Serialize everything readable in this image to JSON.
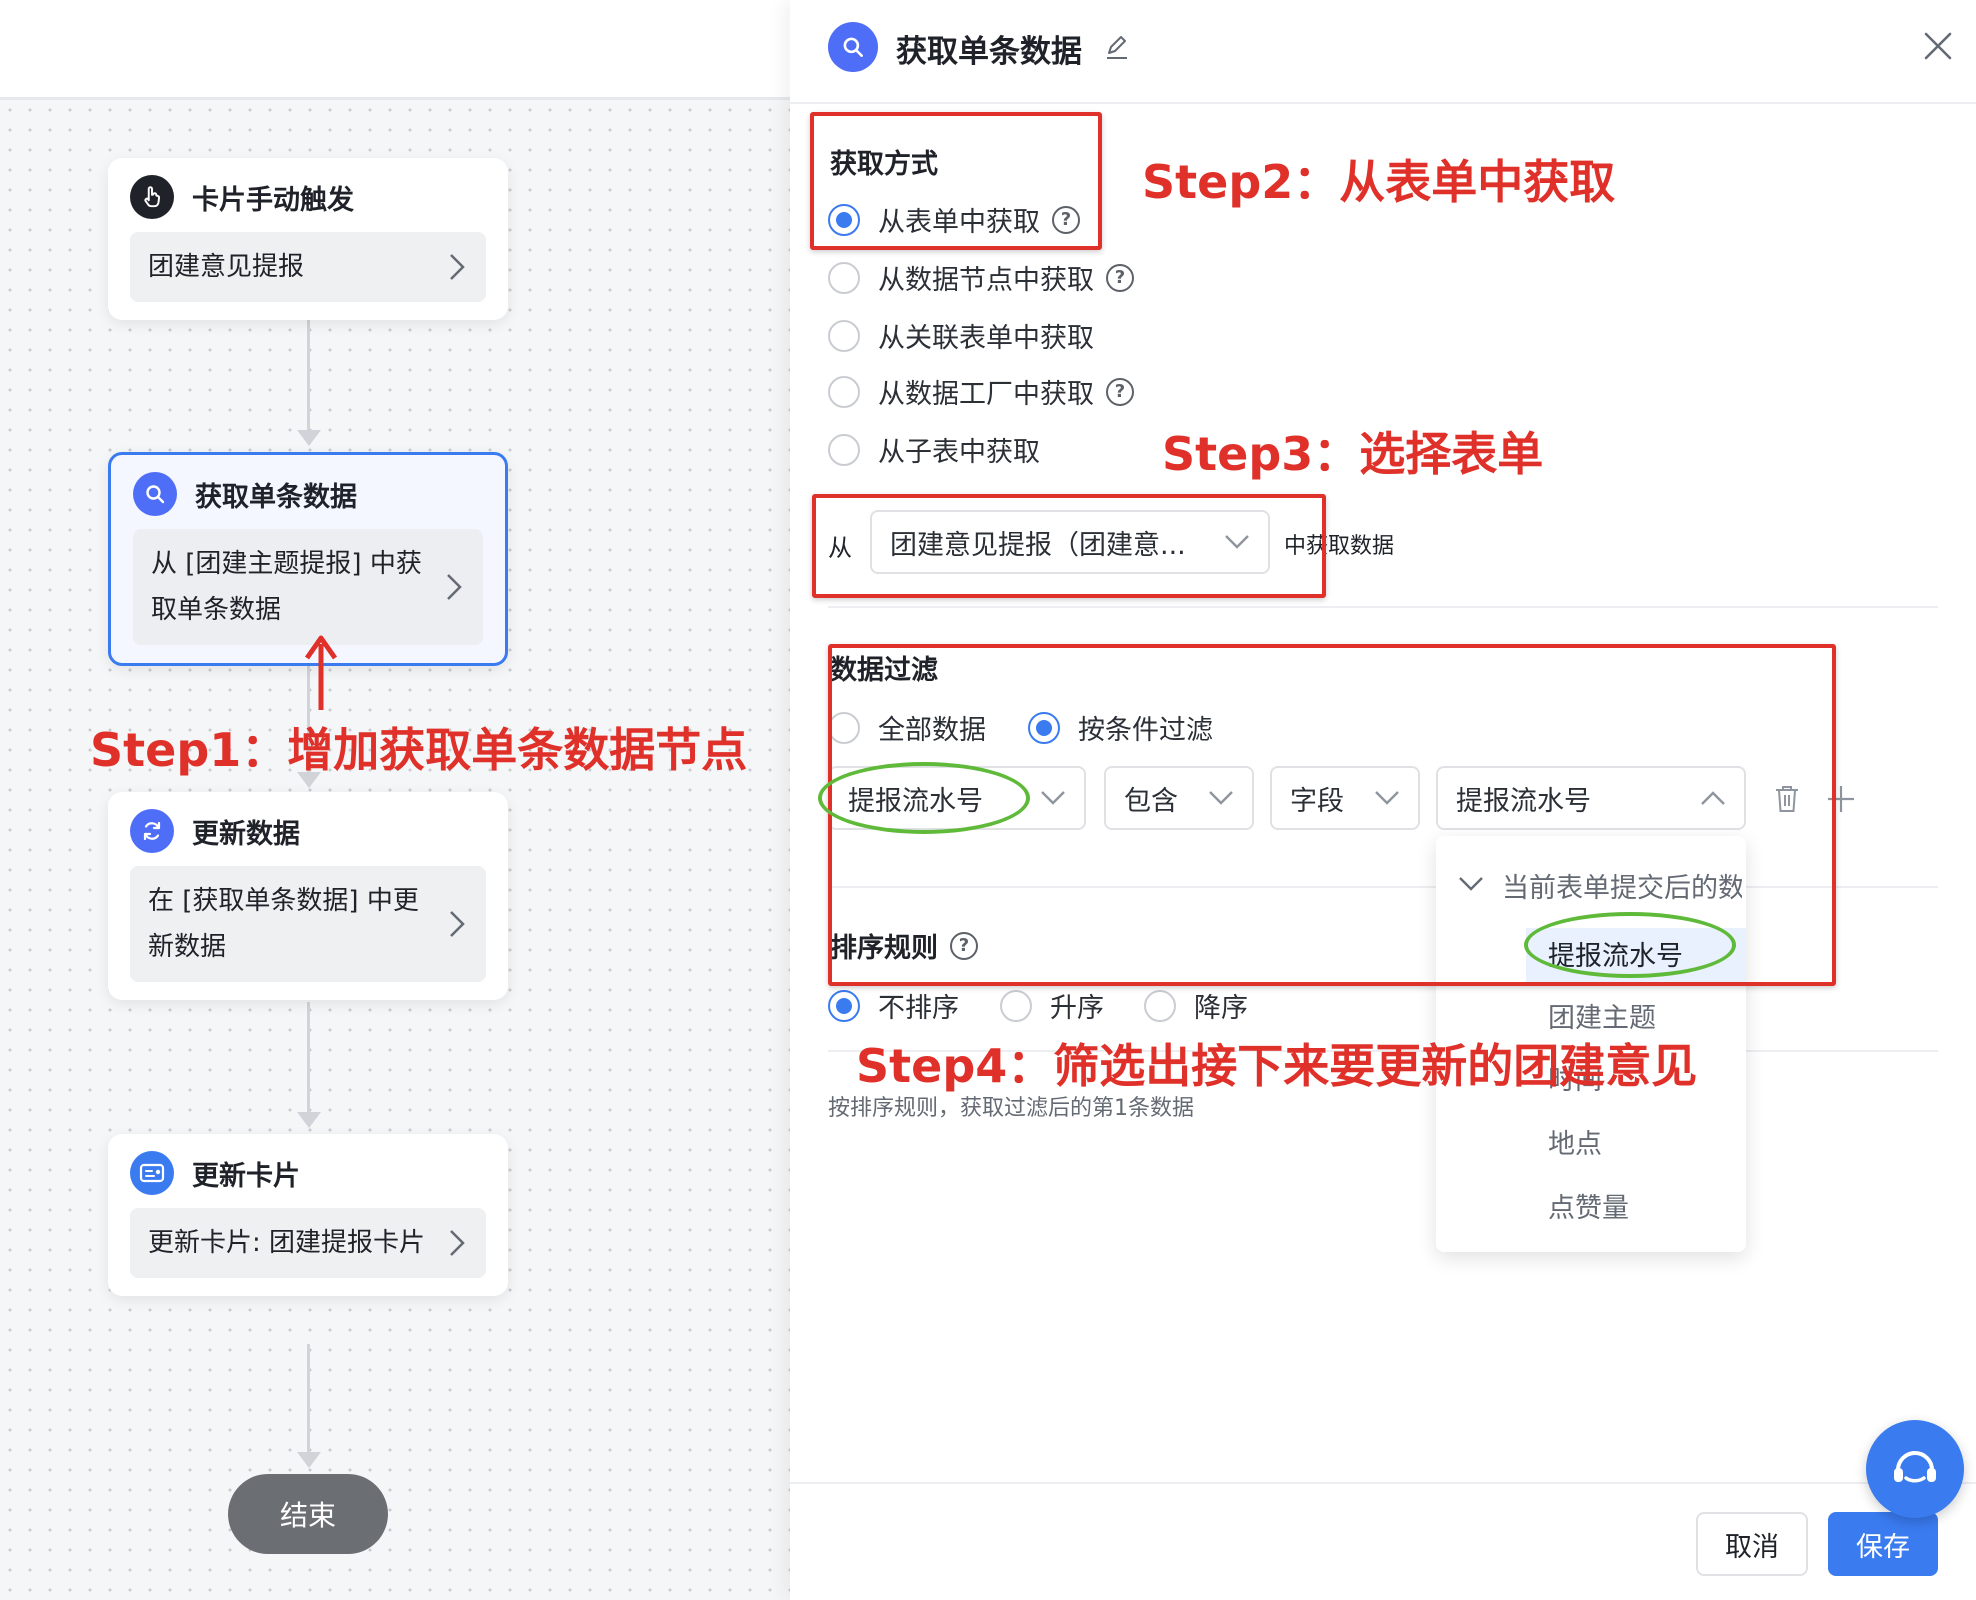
{
  "canvas": {
    "nodes": [
      {
        "title": "卡片手动触发",
        "body": "团建意见提报",
        "icon": "hand-pointer-icon"
      },
      {
        "title": "获取单条数据",
        "body": "从 [团建主题提报] 中获取单条数据",
        "icon": "search-icon"
      },
      {
        "title": "更新数据",
        "body": "在 [获取单条数据] 中更新数据",
        "icon": "refresh-icon"
      },
      {
        "title": "更新卡片",
        "body": "更新卡片: 团建提报卡片",
        "icon": "card-icon"
      }
    ],
    "end_label": "结束"
  },
  "panel": {
    "title": "获取单条数据",
    "fetch_method": {
      "label": "获取方式",
      "options": [
        "从表单中获取",
        "从数据节点中获取",
        "从关联表单中获取",
        "从数据工厂中获取",
        "从子表中获取"
      ],
      "selected": "从表单中获取"
    },
    "source": {
      "prefix": "从",
      "value": "团建意见提报（团建意...",
      "suffix": "中获取数据"
    },
    "filter": {
      "label": "数据过滤",
      "options": [
        "全部数据",
        "按条件过滤"
      ],
      "selected": "按条件过滤",
      "field": "提报流水号",
      "operator": "包含",
      "value_type": "字段",
      "value": "提报流水号"
    },
    "dropdown": {
      "group": "当前表单提交后的数",
      "items": [
        "提报流水号",
        "团建主题",
        "时间",
        "地点",
        "点赞量"
      ],
      "selected": "提报流水号"
    },
    "sort": {
      "label": "排序规则",
      "options": [
        "不排序",
        "升序",
        "降序"
      ],
      "selected": "不排序",
      "hint": "按排序规则，获取过滤后的第1条数据"
    },
    "buttons": {
      "cancel": "取消",
      "save": "保存"
    }
  },
  "annotations": {
    "step1": "Step1：增加获取单条数据节点",
    "step2": "Step2：从表单中获取",
    "step3": "Step3：选择表单",
    "step4": "Step4：筛选出接下来要更新的团建意见"
  },
  "colors": {
    "accent": "#3a7bf0",
    "annotation": "#e0302a",
    "highlight": "#5fba3a"
  }
}
